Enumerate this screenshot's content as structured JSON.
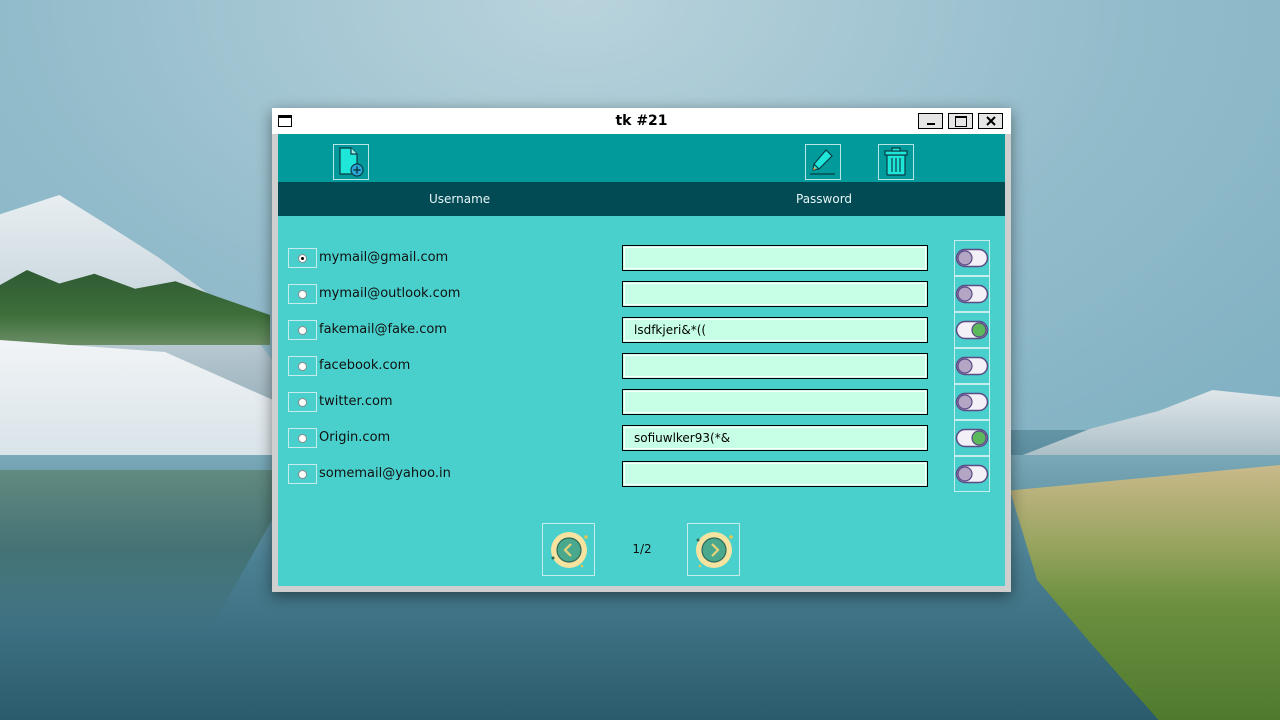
{
  "window": {
    "title": "tk #21"
  },
  "toolbar": {
    "buttons": [
      {
        "name": "add-entry",
        "icon": "add-file-icon"
      },
      {
        "name": "edit-entry",
        "icon": "pencil-icon"
      },
      {
        "name": "delete-entry",
        "icon": "trash-icon"
      }
    ]
  },
  "header": {
    "username": "Username",
    "password": "Password"
  },
  "rows": [
    {
      "username": "mymail@gmail.com",
      "password": "",
      "selected": true,
      "shown": false
    },
    {
      "username": "mymail@outlook.com",
      "password": "",
      "selected": false,
      "shown": false
    },
    {
      "username": "fakemail@fake.com",
      "password": "lsdfkjeri&*((",
      "selected": false,
      "shown": true
    },
    {
      "username": "facebook.com",
      "password": "",
      "selected": false,
      "shown": false
    },
    {
      "username": "twitter.com",
      "password": "",
      "selected": false,
      "shown": false
    },
    {
      "username": "Origin.com",
      "password": "sofiuwlker93(*&",
      "selected": false,
      "shown": true
    },
    {
      "username": "somemail@yahoo.in",
      "password": "",
      "selected": false,
      "shown": false
    }
  ],
  "pager": {
    "page": "1/2",
    "prev_icon": "chevron-left-icon",
    "next_icon": "chevron-right-icon"
  },
  "colors": {
    "client_bg": "#4ad0cc",
    "toolbar_bg": "#029a9a",
    "header_bg": "#024b55",
    "entry_bg": "#c7ffe6",
    "toggle_on": "#5cb85c",
    "toggle_off": "#b3a6c4"
  }
}
